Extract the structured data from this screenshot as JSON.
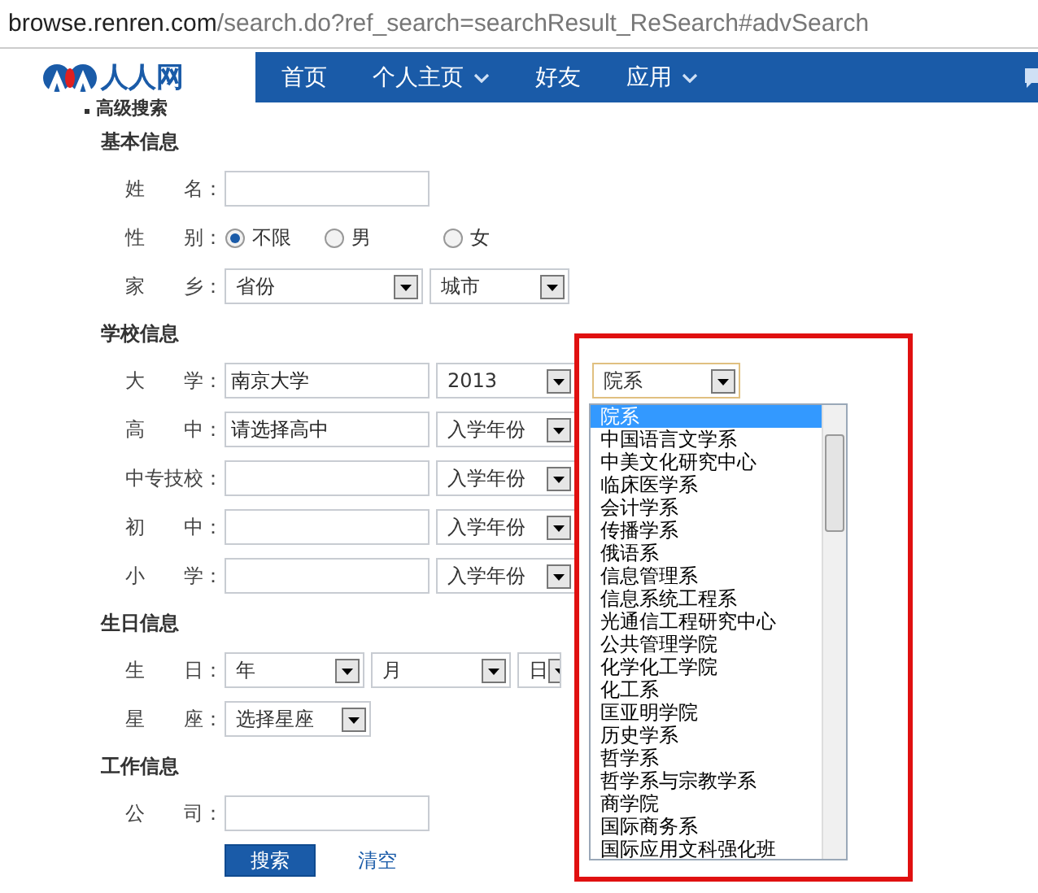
{
  "address_bar": {
    "host": "browse.renren.com",
    "path": "/search.do?ref_search=searchResult_ReSearch#advSearch"
  },
  "nav": {
    "logo": "人人网",
    "items": [
      {
        "label": "首页",
        "dropdown": false
      },
      {
        "label": "个人主页",
        "dropdown": true
      },
      {
        "label": "好友",
        "dropdown": false
      },
      {
        "label": "应用",
        "dropdown": true
      }
    ]
  },
  "page_title": "高级搜索",
  "sections": [
    {
      "title": "基本信息",
      "rows": [
        {
          "kind": "text",
          "label": "姓　　名：",
          "value": ""
        },
        {
          "kind": "radio",
          "label": "性　　别：",
          "options": [
            {
              "label": "不限",
              "selected": true
            },
            {
              "label": "男",
              "selected": false
            },
            {
              "label": "女",
              "selected": false
            }
          ]
        },
        {
          "kind": "selects",
          "label": "家　　乡：",
          "selects": [
            {
              "value": "省份"
            },
            {
              "value": "城市"
            }
          ]
        }
      ]
    },
    {
      "title": "学校信息",
      "rows": [
        {
          "kind": "school",
          "label": "大　　学：",
          "value": "南京大学",
          "year": "2013",
          "department": "院系"
        },
        {
          "kind": "school",
          "label": "高　　中：",
          "value": "请选择高中",
          "year": "入学年份"
        },
        {
          "kind": "school",
          "label": "中专技校：",
          "value": "",
          "year": "入学年份"
        },
        {
          "kind": "school",
          "label": "初　　中：",
          "value": "",
          "year": "入学年份"
        },
        {
          "kind": "school",
          "label": "小　　学：",
          "value": "",
          "year": "入学年份"
        }
      ]
    },
    {
      "title": "生日信息",
      "rows": [
        {
          "kind": "selects",
          "label": "生　　日：",
          "selects": [
            {
              "value": "年"
            },
            {
              "value": "月"
            },
            {
              "value": "日"
            }
          ]
        },
        {
          "kind": "selects",
          "label": "星　　座：",
          "selects": [
            {
              "value": "选择星座"
            }
          ]
        }
      ]
    },
    {
      "title": "工作信息",
      "rows": [
        {
          "kind": "text",
          "label": "公　　司：",
          "value": ""
        }
      ]
    }
  ],
  "buttons": [
    {
      "label": "搜索",
      "kind": "primary"
    },
    {
      "label": "清空",
      "kind": "link"
    }
  ],
  "dropdown_list": {
    "items": [
      {
        "label": "院系",
        "selected": true
      },
      {
        "label": "中国语言文学系",
        "selected": false
      },
      {
        "label": "中美文化研究中心",
        "selected": false
      },
      {
        "label": "临床医学系",
        "selected": false
      },
      {
        "label": "会计学系",
        "selected": false
      },
      {
        "label": "传播学系",
        "selected": false
      },
      {
        "label": "俄语系",
        "selected": false
      },
      {
        "label": "信息管理系",
        "selected": false
      },
      {
        "label": "信息系统工程系",
        "selected": false
      },
      {
        "label": "光通信工程研究中心",
        "selected": false
      },
      {
        "label": "公共管理学院",
        "selected": false
      },
      {
        "label": "化学化工学院",
        "selected": false
      },
      {
        "label": "化工系",
        "selected": false
      },
      {
        "label": "匡亚明学院",
        "selected": false
      },
      {
        "label": "历史学系",
        "selected": false
      },
      {
        "label": "哲学系",
        "selected": false
      },
      {
        "label": "哲学系与宗教学系",
        "selected": false
      },
      {
        "label": "商学院",
        "selected": false
      },
      {
        "label": "国际商务系",
        "selected": false
      },
      {
        "label": "国际应用文科强化班",
        "selected": false
      }
    ]
  }
}
